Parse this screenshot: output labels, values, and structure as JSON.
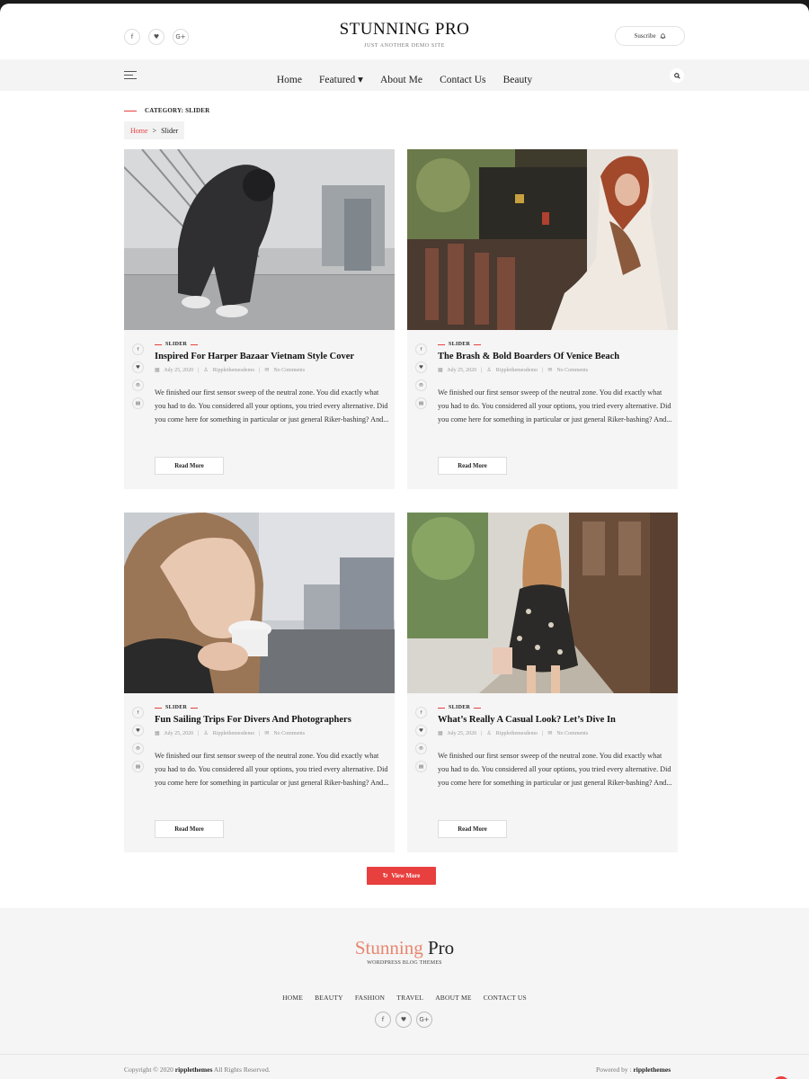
{
  "header": {
    "title": "STUNNING PRO",
    "tagline": "JUST ANOTHER DEMO SITE",
    "social": [
      {
        "icon": "facebook-icon",
        "glyph": "f"
      },
      {
        "icon": "twitter-icon",
        "glyph": "♥"
      },
      {
        "icon": "google-plus-icon",
        "glyph": "G+"
      }
    ],
    "subscribe_label": "Suscribe"
  },
  "nav": {
    "items": [
      "Home",
      "Featured ▾",
      "About Me",
      "Contact Us",
      "Beauty"
    ]
  },
  "category": {
    "heading": "CATEGORY: SLIDER",
    "breadcrumb_home": "Home",
    "breadcrumb_sep": ">",
    "breadcrumb_current": "Slider"
  },
  "posts": [
    {
      "category": "SLIDER",
      "title": "Inspired For Harper Bazaar Vietnam Style Cover",
      "date": "July 25, 2020",
      "author": "Ripplethemesdemo",
      "comments": "No Comments",
      "excerpt": "We finished our first sensor sweep of the neutral zone. You did exactly what you had to do. You considered all your options, you tried every alternative. Did you come here for something in particular or just general Riker-bashing? And...",
      "read_more": "Read More"
    },
    {
      "category": "SLIDER",
      "title": "The Brash & Bold Boarders Of Venice Beach",
      "date": "July 25, 2020",
      "author": "Ripplethemesdemo",
      "comments": "No Comments",
      "excerpt": "We finished our first sensor sweep of the neutral zone. You did exactly what you had to do. You considered all your options, you tried every alternative. Did you come here for something in particular or just general Riker-bashing? And...",
      "read_more": "Read More"
    },
    {
      "category": "SLIDER",
      "title": "Fun Sailing Trips For Divers And Photographers",
      "date": "July 25, 2020",
      "author": "Ripplethemesdemo",
      "comments": "No Comments",
      "excerpt": "We finished our first sensor sweep of the neutral zone. You did exactly what you had to do. You considered all your options, you tried every alternative. Did you come here for something in particular or just general Riker-bashing? And...",
      "read_more": "Read More"
    },
    {
      "category": "SLIDER",
      "title": "What’s Really A Casual Look? Let’s Dive In",
      "date": "July 25, 2020",
      "author": "Ripplethemesdemo",
      "comments": "No Comments",
      "excerpt": "We finished our first sensor sweep of the neutral zone. You did exactly what you had to do. You considered all your options, you tried every alternative. Did you come here for something in particular or just general Riker-bashing? And...",
      "read_more": "Read More"
    }
  ],
  "view_more": "View More",
  "footer": {
    "logo_first": "Stunning",
    "logo_second": "Pro",
    "tagline": "WORDPRESS BLOG THEMES",
    "menu": [
      "HOME",
      "BEAUTY",
      "FASHION",
      "TRAVEL",
      "ABOUT ME",
      "CONTACT US"
    ],
    "copyright_prefix": "Copyright © 2020",
    "copyright_brand": "ripplethemes",
    "copyright_suffix": "All Rights Reserved.",
    "powered_prefix": "Powered by :",
    "powered_brand": "ripplethemes"
  },
  "colors": {
    "accent": "#e8403f",
    "logo_accent": "#e8866e"
  }
}
